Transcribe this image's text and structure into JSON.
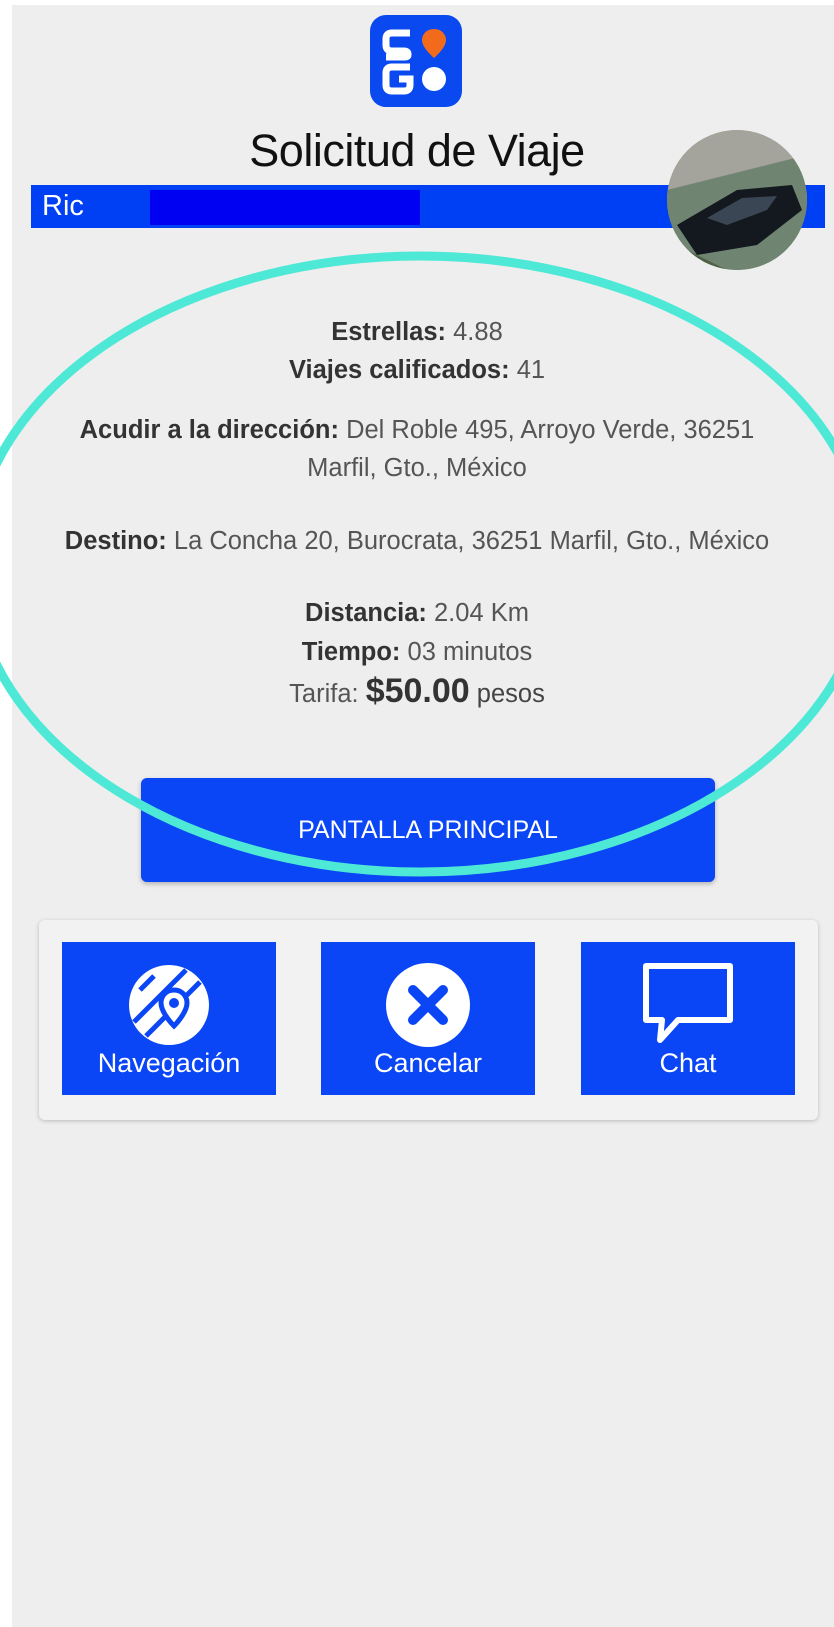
{
  "header": {
    "logo_text": "SIGO",
    "title": "Solicitud de Viaje"
  },
  "driver": {
    "name": "Ric",
    "avatar_icon": "car-photo-avatar"
  },
  "trip": {
    "stars_label": "Estrellas:",
    "stars_value": "4.88",
    "rated_trips_label": "Viajes calificados:",
    "rated_trips_value": "41",
    "pickup_label": "Acudir a la dirección:",
    "pickup_value_line1": "Del Roble 495, Arroyo Verde, 36251",
    "pickup_value_line2": "Marfil, Gto., México",
    "destination_label": "Destino:",
    "destination_value": "La Concha 20, Burocrata, 36251 Marfil, Gto., México",
    "distance_label": "Distancia:",
    "distance_value": "2.04 Km",
    "time_label": "Tiempo:",
    "time_value": "03 minutos",
    "fare_label": "Tarifa:",
    "fare_amount": "$50.00",
    "fare_unit": "pesos"
  },
  "buttons": {
    "main": "PANTALLA PRINCIPAL",
    "navigation": "Navegación",
    "cancel": "Cancelar",
    "chat": "Chat"
  },
  "colors": {
    "primary_blue": "#0a46f5",
    "highlight_ellipse": "#4de8d6",
    "logo_orange": "#f26a1b"
  }
}
